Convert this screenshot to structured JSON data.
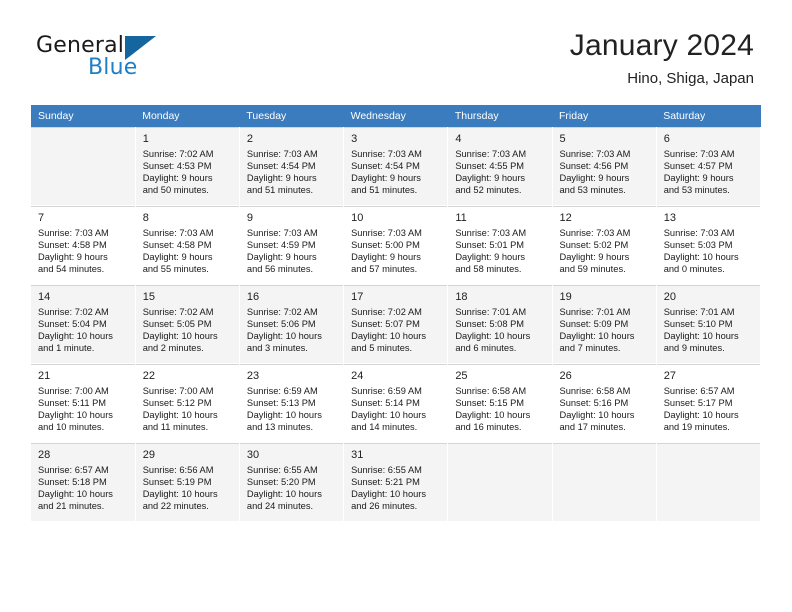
{
  "brand": {
    "word_one": "General",
    "word_two": "Blue",
    "logo_icon": "triangle-logo-icon",
    "accent_color": "#15659f",
    "blue_text_color": "#1f7fc4"
  },
  "header": {
    "title": "January 2024",
    "subtitle": "Hino, Shiga, Japan"
  },
  "calendar": {
    "header_bg": "#3b7cbe",
    "header_text_color": "#ffffff",
    "shaded_row_bg": "#f4f4f4",
    "weekday_headers": [
      "Sunday",
      "Monday",
      "Tuesday",
      "Wednesday",
      "Thursday",
      "Friday",
      "Saturday"
    ],
    "weeks": [
      [
        {
          "day": "",
          "detail": ""
        },
        {
          "day": "1",
          "detail": "Sunrise: 7:02 AM\nSunset: 4:53 PM\nDaylight: 9 hours\nand 50 minutes."
        },
        {
          "day": "2",
          "detail": "Sunrise: 7:03 AM\nSunset: 4:54 PM\nDaylight: 9 hours\nand 51 minutes."
        },
        {
          "day": "3",
          "detail": "Sunrise: 7:03 AM\nSunset: 4:54 PM\nDaylight: 9 hours\nand 51 minutes."
        },
        {
          "day": "4",
          "detail": "Sunrise: 7:03 AM\nSunset: 4:55 PM\nDaylight: 9 hours\nand 52 minutes."
        },
        {
          "day": "5",
          "detail": "Sunrise: 7:03 AM\nSunset: 4:56 PM\nDaylight: 9 hours\nand 53 minutes."
        },
        {
          "day": "6",
          "detail": "Sunrise: 7:03 AM\nSunset: 4:57 PM\nDaylight: 9 hours\nand 53 minutes."
        }
      ],
      [
        {
          "day": "7",
          "detail": "Sunrise: 7:03 AM\nSunset: 4:58 PM\nDaylight: 9 hours\nand 54 minutes."
        },
        {
          "day": "8",
          "detail": "Sunrise: 7:03 AM\nSunset: 4:58 PM\nDaylight: 9 hours\nand 55 minutes."
        },
        {
          "day": "9",
          "detail": "Sunrise: 7:03 AM\nSunset: 4:59 PM\nDaylight: 9 hours\nand 56 minutes."
        },
        {
          "day": "10",
          "detail": "Sunrise: 7:03 AM\nSunset: 5:00 PM\nDaylight: 9 hours\nand 57 minutes."
        },
        {
          "day": "11",
          "detail": "Sunrise: 7:03 AM\nSunset: 5:01 PM\nDaylight: 9 hours\nand 58 minutes."
        },
        {
          "day": "12",
          "detail": "Sunrise: 7:03 AM\nSunset: 5:02 PM\nDaylight: 9 hours\nand 59 minutes."
        },
        {
          "day": "13",
          "detail": "Sunrise: 7:03 AM\nSunset: 5:03 PM\nDaylight: 10 hours\nand 0 minutes."
        }
      ],
      [
        {
          "day": "14",
          "detail": "Sunrise: 7:02 AM\nSunset: 5:04 PM\nDaylight: 10 hours\nand 1 minute."
        },
        {
          "day": "15",
          "detail": "Sunrise: 7:02 AM\nSunset: 5:05 PM\nDaylight: 10 hours\nand 2 minutes."
        },
        {
          "day": "16",
          "detail": "Sunrise: 7:02 AM\nSunset: 5:06 PM\nDaylight: 10 hours\nand 3 minutes."
        },
        {
          "day": "17",
          "detail": "Sunrise: 7:02 AM\nSunset: 5:07 PM\nDaylight: 10 hours\nand 5 minutes."
        },
        {
          "day": "18",
          "detail": "Sunrise: 7:01 AM\nSunset: 5:08 PM\nDaylight: 10 hours\nand 6 minutes."
        },
        {
          "day": "19",
          "detail": "Sunrise: 7:01 AM\nSunset: 5:09 PM\nDaylight: 10 hours\nand 7 minutes."
        },
        {
          "day": "20",
          "detail": "Sunrise: 7:01 AM\nSunset: 5:10 PM\nDaylight: 10 hours\nand 9 minutes."
        }
      ],
      [
        {
          "day": "21",
          "detail": "Sunrise: 7:00 AM\nSunset: 5:11 PM\nDaylight: 10 hours\nand 10 minutes."
        },
        {
          "day": "22",
          "detail": "Sunrise: 7:00 AM\nSunset: 5:12 PM\nDaylight: 10 hours\nand 11 minutes."
        },
        {
          "day": "23",
          "detail": "Sunrise: 6:59 AM\nSunset: 5:13 PM\nDaylight: 10 hours\nand 13 minutes."
        },
        {
          "day": "24",
          "detail": "Sunrise: 6:59 AM\nSunset: 5:14 PM\nDaylight: 10 hours\nand 14 minutes."
        },
        {
          "day": "25",
          "detail": "Sunrise: 6:58 AM\nSunset: 5:15 PM\nDaylight: 10 hours\nand 16 minutes."
        },
        {
          "day": "26",
          "detail": "Sunrise: 6:58 AM\nSunset: 5:16 PM\nDaylight: 10 hours\nand 17 minutes."
        },
        {
          "day": "27",
          "detail": "Sunrise: 6:57 AM\nSunset: 5:17 PM\nDaylight: 10 hours\nand 19 minutes."
        }
      ],
      [
        {
          "day": "28",
          "detail": "Sunrise: 6:57 AM\nSunset: 5:18 PM\nDaylight: 10 hours\nand 21 minutes."
        },
        {
          "day": "29",
          "detail": "Sunrise: 6:56 AM\nSunset: 5:19 PM\nDaylight: 10 hours\nand 22 minutes."
        },
        {
          "day": "30",
          "detail": "Sunrise: 6:55 AM\nSunset: 5:20 PM\nDaylight: 10 hours\nand 24 minutes."
        },
        {
          "day": "31",
          "detail": "Sunrise: 6:55 AM\nSunset: 5:21 PM\nDaylight: 10 hours\nand 26 minutes."
        },
        {
          "day": "",
          "detail": ""
        },
        {
          "day": "",
          "detail": ""
        },
        {
          "day": "",
          "detail": ""
        }
      ]
    ]
  }
}
